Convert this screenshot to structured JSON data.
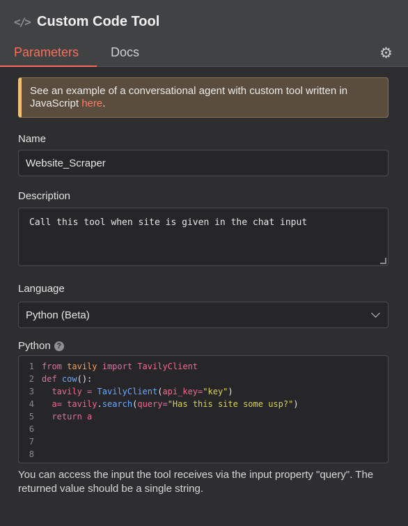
{
  "header": {
    "icon": "code-icon",
    "title": "Custom Code Tool",
    "tabs": [
      {
        "label": "Parameters",
        "active": true
      },
      {
        "label": "Docs",
        "active": false
      }
    ],
    "settings_icon": "gear-icon"
  },
  "callout": {
    "text": "See an example of a conversational agent with custom tool written in JavaScript ",
    "link_text": "here",
    "suffix": "."
  },
  "name": {
    "label": "Name",
    "value": "Website_Scraper"
  },
  "description": {
    "label": "Description",
    "value": "Call this tool when site is given in the chat input"
  },
  "language": {
    "label": "Language",
    "selected": "Python (Beta)"
  },
  "python": {
    "label": "Python",
    "line_numbers": [
      "1",
      "2",
      "3",
      "4",
      "5",
      "6",
      "7",
      "8"
    ],
    "lines": [
      "from tavily import TavilyClient",
      "def cow():",
      "  tavily = TavilyClient(api_key=\"key\")",
      "  a= tavily.search(query=\"Has this site some usp?\")",
      "  return a",
      "",
      "",
      ""
    ]
  },
  "hint": "You can access the input the tool receives via the input property \"query\". The returned value should be a single string.",
  "colors": {
    "accent": "#ff6d5a",
    "callout_border": "#f2bf7a",
    "background": "#2e2e30"
  }
}
